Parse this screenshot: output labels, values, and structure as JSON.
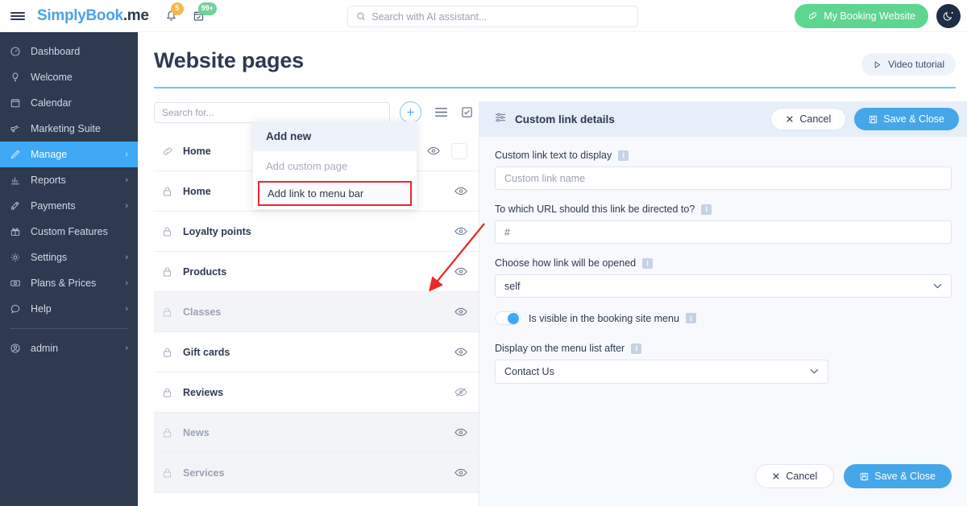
{
  "topbar": {
    "menu_icon": "hamburger-icon",
    "logo_simply": "S",
    "logo_mid": "implyBook",
    "logo_suffix": ".me",
    "bell_badge": "5",
    "calendar_badge": "99+",
    "search_placeholder": "Search with AI assistant...",
    "search_value": "",
    "my_booking_website": "My Booking Website",
    "dark_mode_icon": "moon-icon"
  },
  "sidebar": {
    "items": [
      {
        "label": "Dashboard",
        "icon": "dashboard-icon",
        "chevron": "",
        "active": false
      },
      {
        "label": "Welcome",
        "icon": "bulb-icon",
        "chevron": "",
        "active": false
      },
      {
        "label": "Calendar",
        "icon": "calendar-icon",
        "chevron": "",
        "active": false
      },
      {
        "label": "Marketing Suite",
        "icon": "megaphone-icon",
        "chevron": "",
        "active": false
      },
      {
        "label": "Manage",
        "icon": "pencil-icon",
        "chevron": "›",
        "active": true
      },
      {
        "label": "Reports",
        "icon": "chart-icon",
        "chevron": "›",
        "active": false
      },
      {
        "label": "Payments",
        "icon": "coins-icon",
        "chevron": "›",
        "active": false
      },
      {
        "label": "Custom Features",
        "icon": "gift-icon",
        "chevron": "",
        "active": false
      },
      {
        "label": "Settings",
        "icon": "gear-icon",
        "chevron": "›",
        "active": false
      },
      {
        "label": "Plans & Prices",
        "icon": "money-icon",
        "chevron": "›",
        "active": false
      },
      {
        "label": "Help",
        "icon": "chat-icon",
        "chevron": "›",
        "active": false
      }
    ],
    "account": {
      "label": "admin",
      "icon": "user-icon",
      "chevron": "›"
    }
  },
  "page": {
    "title": "Website pages",
    "video_tutorial": "Video tutorial",
    "play_icon": "play-icon"
  },
  "list_toolbar": {
    "search_placeholder": "Search for...",
    "search_value": "",
    "add_icon": "plus-icon",
    "reorder_icon": "list-icon",
    "select_icon": "checkbox-icon"
  },
  "dropdown": {
    "header": "Add new",
    "items": [
      {
        "label": "Add custom page",
        "state": "disabled"
      },
      {
        "label": "Add link to menu bar",
        "state": "highlight"
      }
    ]
  },
  "pages": [
    {
      "label": "Home",
      "icon": "link-icon",
      "eye": "eye-icon",
      "dim": false,
      "checkbox": true
    },
    {
      "label": "Home",
      "icon": "lock-icon",
      "eye": "eye-icon",
      "dim": false,
      "checkbox": false
    },
    {
      "label": "Loyalty points",
      "icon": "lock-icon",
      "eye": "eye-icon",
      "dim": false,
      "checkbox": false
    },
    {
      "label": "Products",
      "icon": "lock-icon",
      "eye": "eye-icon",
      "dim": false,
      "checkbox": false
    },
    {
      "label": "Classes",
      "icon": "lock-icon",
      "eye": "eye-icon",
      "dim": true,
      "checkbox": false
    },
    {
      "label": "Gift cards",
      "icon": "lock-icon",
      "eye": "eye-icon",
      "dim": false,
      "checkbox": false
    },
    {
      "label": "Reviews",
      "icon": "lock-icon",
      "eye": "eye-off-icon",
      "dim": false,
      "checkbox": false
    },
    {
      "label": "News",
      "icon": "lock-icon",
      "eye": "eye-icon",
      "dim": true,
      "checkbox": false
    },
    {
      "label": "Services",
      "icon": "lock-icon",
      "eye": "eye-icon",
      "dim": true,
      "checkbox": false
    }
  ],
  "detail": {
    "title": "Custom link details",
    "settings_icon": "sliders-icon",
    "cancel_label": "Cancel",
    "save_label": "Save & Close",
    "save_icon": "floppy-icon",
    "close_icon": "x-icon",
    "fields": {
      "link_text_label": "Custom link text to display",
      "link_text_placeholder": "Custom link name",
      "link_text_value": "",
      "url_label": "To which URL should this link be directed to?",
      "url_value": "#",
      "target_label": "Choose how link will be opened",
      "target_value": "self",
      "visible_label": "Is visible in the booking site menu",
      "visible_on": true,
      "order_label": "Display on the menu list after",
      "order_value": "Contact Us"
    },
    "footer": {
      "cancel_label": "Cancel",
      "save_label": "Save & Close"
    }
  },
  "colors": {
    "sidebar_bg": "#2d3a50",
    "accent_blue": "#3fa9f5",
    "green": "#5ed68f",
    "highlight_red": "#e8292b",
    "panel_bg": "#f7f9fc"
  }
}
